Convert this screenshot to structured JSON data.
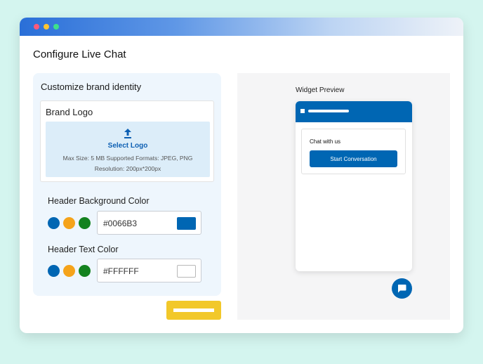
{
  "page": {
    "title": "Configure Live Chat"
  },
  "customize": {
    "section_title": "Customize brand identity",
    "brand_logo": {
      "label": "Brand Logo",
      "select_label": "Select Logo",
      "meta_line1": "Max Size: 5 MB Supported Formats: JPEG, PNG",
      "meta_line2": "Resolution: 200px*200px",
      "icon": "upload-icon"
    },
    "header_bg": {
      "label": "Header Background Color",
      "value": "#0066B3",
      "swatches": [
        "#0066b3",
        "#f5a31a",
        "#13821f"
      ]
    },
    "header_text": {
      "label": "Header Text Color",
      "value": "#FFFFFF",
      "swatches": [
        "#0066b3",
        "#f5a31a",
        "#13821f"
      ]
    }
  },
  "preview": {
    "title": "Widget Preview",
    "chat_with_us": "Chat with us",
    "start_button": "Start Conversation",
    "header_color": "#0066b3",
    "fab_icon": "chat-bubble-icon"
  },
  "colors": {
    "accent": "#0066b3",
    "save_button": "#f2c82a",
    "background": "#d4f5ef"
  }
}
